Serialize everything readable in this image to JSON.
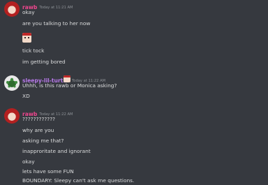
{
  "messages": [
    {
      "author": "rawb",
      "timestamp": "Today at 11:21 AM",
      "lines": [
        "okay",
        "are you talking to her now",
        "tick tock",
        "im getting bored"
      ]
    },
    {
      "author": "sleepy-lil-turtle",
      "timestamp": "Today at 11:22 AM",
      "lines": [
        "Uhhh, is this rawb or Monica asking?",
        "XD"
      ]
    },
    {
      "author": "rawb",
      "timestamp": "Today at 11:22 AM",
      "lines": [
        "????????????",
        "why are you",
        "asking me that?",
        "inapproritate and ignorant",
        "okay",
        "lets have some FUN",
        "BOUNDARY: Sleepy can't ask me questions."
      ]
    }
  ],
  "colors": {
    "background": "#36393f",
    "rawb_name": "#f0468e",
    "turtle_name": "#b678e8",
    "message_text": "#dcddde",
    "timestamp": "#8e9297"
  }
}
